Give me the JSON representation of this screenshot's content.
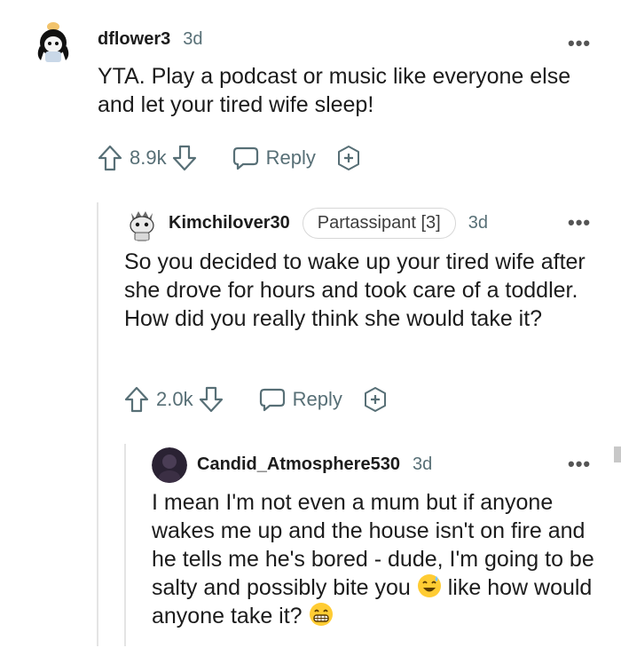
{
  "comments": [
    {
      "username": "dflower3",
      "time": "3d",
      "body": "YTA. Play a podcast or music like everyone else and let your tired wife sleep!",
      "votes": "8.9k",
      "reply_label": "Reply"
    },
    {
      "username": "Kimchilover30",
      "flair": "Partassipant [3]",
      "time": "3d",
      "body": "So you decided to wake up your tired wife after she drove for hours and took care of a toddler. How did you really think she would take it?",
      "votes": "2.0k",
      "reply_label": "Reply"
    },
    {
      "username": "Candid_Atmosphere530",
      "time": "3d",
      "body_part1": "I mean I'm not even a mum but if anyone wakes me up and the house isn't on fire and he tells me he's bored - dude, I'm going to be salty and possibly bite you",
      "body_part2": " like how would anyone take it? "
    }
  ],
  "icons": [
    "upvote-icon",
    "downvote-icon",
    "reply-bubble-icon",
    "award-plus-icon",
    "more-options-icon",
    "sweat-smile-emoji",
    "grin-emoji"
  ],
  "colors": {
    "meta_gray": "#576f76",
    "text": "#1c1c1c",
    "thread_line": "#e4e4e4"
  }
}
